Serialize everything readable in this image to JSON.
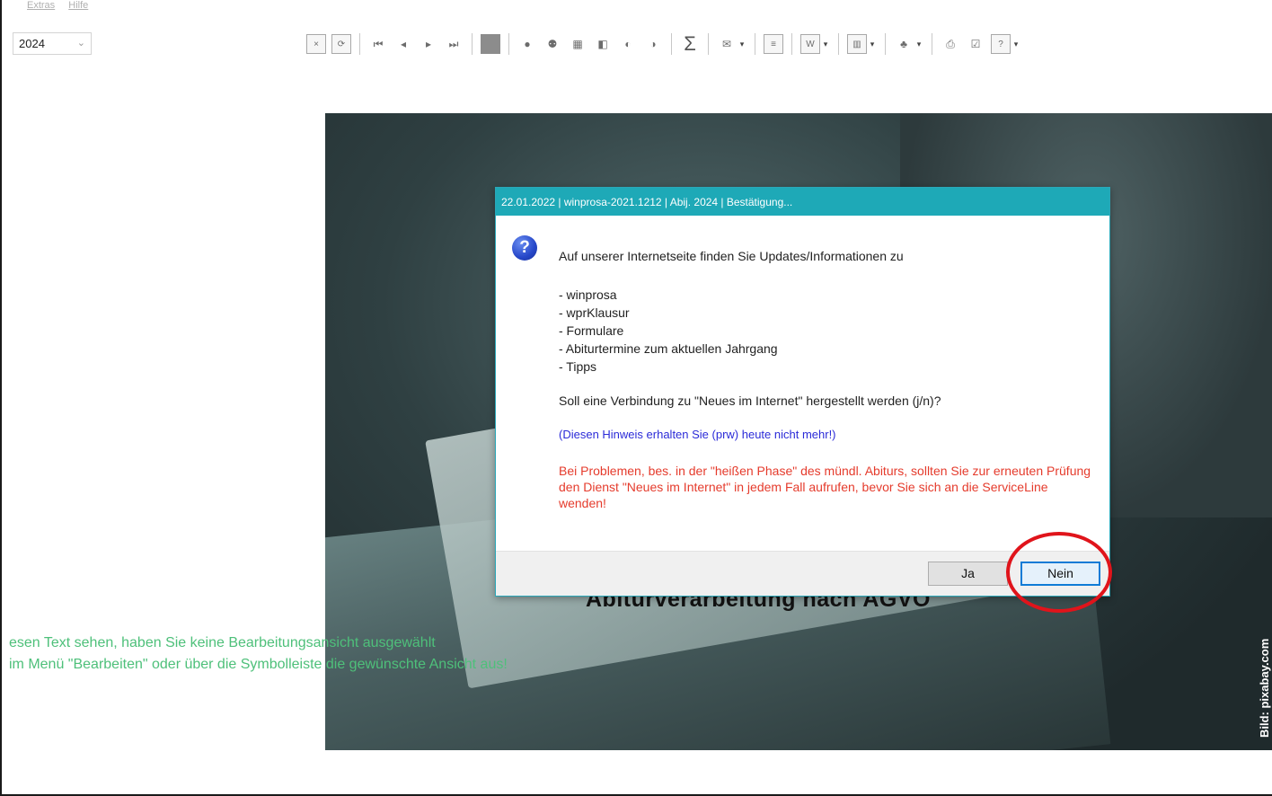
{
  "menubar": {
    "items": [
      "Extras",
      "Hilfe"
    ]
  },
  "year_select": {
    "value": "2024"
  },
  "toolbar": {
    "sigma": "Σ"
  },
  "hero": {
    "title": "Abiturverarbeitung nach AGVO",
    "photo_credit": "Bild: pixabay.com"
  },
  "hint": {
    "line1": "esen Text sehen, haben Sie keine Bearbeitungsansicht ausgewählt",
    "line2": " im Menü \"Bearbeiten\" oder über die Symbolleiste die gewünschte Ansicht aus!"
  },
  "dialog": {
    "title": "22.01.2022 | winprosa-2021.1212 | Abij. 2024 | Bestätigung...",
    "intro": "Auf unserer Internetseite finden Sie Updates/Informationen zu",
    "items": [
      "- winprosa",
      "- wprKlausur",
      "- Formulare",
      "- Abiturtermine zum aktuellen Jahrgang",
      "- Tipps"
    ],
    "question": "Soll eine Verbindung zu \"Neues im Internet\" hergestellt werden (j/n)?",
    "blue_note": "(Diesen Hinweis erhalten Sie (prw) heute nicht mehr!)",
    "red_note": "Bei Problemen, bes. in der \"heißen Phase\" des mündl. Abiturs, sollten Sie zur erneuten Prüfung den Dienst \"Neues im Internet\" in jedem Fall aufrufen, bevor Sie sich an die ServiceLine wenden!",
    "yes_label": "Ja",
    "no_label": "Nein"
  },
  "colors": {
    "titlebar": "#1ea9b7",
    "highlight_ring": "#e0141b",
    "hint_text": "#4ec07a",
    "blue_note": "#2b2bd8",
    "red_note": "#e53b2c"
  }
}
